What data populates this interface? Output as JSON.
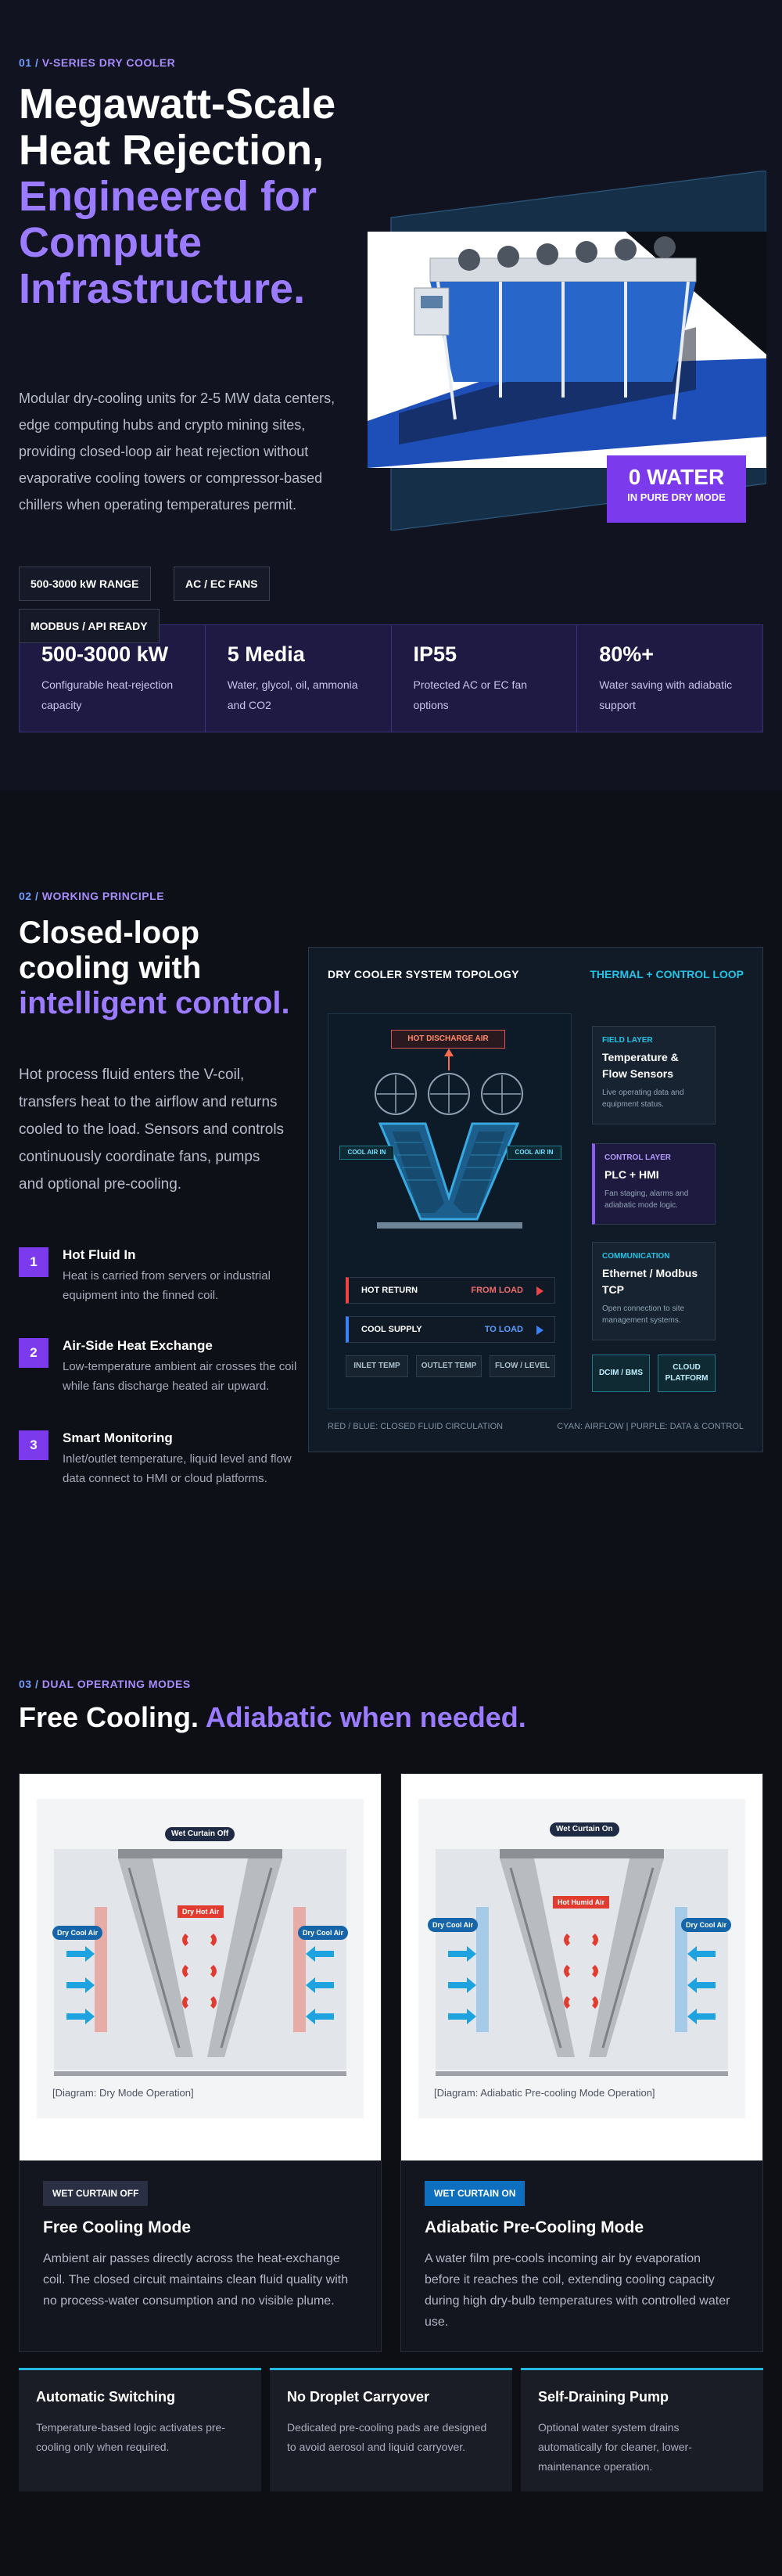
{
  "hero": {
    "eyebrow_num": "01 /",
    "eyebrow_label": "V-SERIES DRY COOLER",
    "title_white": "Megawatt-Scale Heat Rejection,",
    "title_accent": "Engineered for Compute Infrastructure.",
    "description": "Modular dry-cooling units for 2-5 MW data centers, edge computing hubs and crypto mining sites, providing closed-loop air heat rejection without evaporative cooling towers or compressor-based chillers when operating temperatures permit.",
    "tags": [
      "500-3000 kW RANGE",
      "AC / EC FANS",
      "MODBUS / API READY"
    ],
    "badge_big": "0 WATER",
    "badge_small": "IN PURE DRY MODE",
    "stats": [
      {
        "value": "500-3000 kW",
        "label": "Configurable heat-rejection capacity"
      },
      {
        "value": "5 Media",
        "label": "Water, glycol, oil, ammonia and CO2"
      },
      {
        "value": "IP55",
        "label": "Protected AC or EC fan options"
      },
      {
        "value": "80%+",
        "label": "Water saving with adiabatic support"
      }
    ]
  },
  "principle": {
    "eyebrow_num": "02 /",
    "eyebrow_label": "WORKING PRINCIPLE",
    "title_white": "Closed-loop cooling with",
    "title_accent": "intelligent control.",
    "description": "Hot process fluid enters the V-coil, transfers heat to the airflow and returns cooled to the load. Sensors and controls continuously coordinate fans, pumps and optional pre-cooling.",
    "steps": [
      {
        "num": "1",
        "title": "Hot Fluid In",
        "body": "Heat is carried from servers or industrial equipment into the finned coil."
      },
      {
        "num": "2",
        "title": "Air-Side Heat Exchange",
        "body": "Low-temperature ambient air crosses the coil while fans discharge heated air upward."
      },
      {
        "num": "3",
        "title": "Smart Monitoring",
        "body": "Inlet/outlet temperature, liquid level and flow data connect to HMI or cloud platforms."
      }
    ],
    "topology": {
      "title": "DRY COOLER SYSTEM TOPOLOGY",
      "title_right": "THERMAL + CONTROL LOOP",
      "hot_discharge": "HOT DISCHARGE AIR",
      "cool_air_left": "COOL AIR IN",
      "cool_air_right": "COOL AIR IN",
      "hot_return": "HOT RETURN",
      "from_load": "FROM LOAD",
      "cool_supply": "COOL SUPPLY",
      "to_load": "TO LOAD",
      "sensors": [
        "INLET TEMP",
        "OUTLET TEMP",
        "FLOW / LEVEL"
      ],
      "layers": [
        {
          "kicker": "FIELD LAYER",
          "title": "Temperature & Flow Sensors",
          "body": "Live operating data and equipment status."
        },
        {
          "kicker": "CONTROL LAYER",
          "title": "PLC + HMI",
          "body": "Fan staging, alarms and adiabatic mode logic."
        },
        {
          "kicker": "COMMUNICATION",
          "title": "Ethernet / Modbus TCP",
          "body": "Open connection to site management systems."
        }
      ],
      "chip_dcim": "DCIM / BMS",
      "chip_cloud": "CLOUD PLATFORM",
      "foot_left": "RED / BLUE: CLOSED FLUID CIRCULATION",
      "foot_right": "CYAN: AIRFLOW | PURPLE: DATA & CONTROL"
    }
  },
  "modes": {
    "eyebrow_num": "03 /",
    "eyebrow_label": "DUAL OPERATING MODES",
    "title_white": "Free Cooling.",
    "title_accent": "Adiabatic when needed.",
    "cards": [
      {
        "img_top_label": "Wet Curtain Off",
        "left_label": "Dry Cool Air",
        "right_label": "Dry Cool Air",
        "center_label": "Dry Hot Air",
        "caption": "[Diagram: Dry Mode Operation]",
        "badge": "WET CURTAIN OFF",
        "title": "Free Cooling Mode",
        "body": "Ambient air passes directly across the heat-exchange coil. The closed circuit maintains clean fluid quality with no process-water consumption and no visible plume."
      },
      {
        "img_top_label": "Wet Curtain On",
        "left_label": "Dry Cool Air",
        "right_label": "Dry Cool Air",
        "center_label": "Hot Humid Air",
        "caption": "[Diagram: Adiabatic Pre-cooling Mode Operation]",
        "badge": "WET CURTAIN ON",
        "title": "Adiabatic Pre-Cooling Mode",
        "body": "A water film pre-cools incoming air by evaporation before it reaches the coil, extending cooling capacity during high dry-bulb temperatures with controlled water use."
      }
    ],
    "features": [
      {
        "title": "Automatic Switching",
        "body": "Temperature-based logic activates pre-cooling only when required."
      },
      {
        "title": "No Droplet Carryover",
        "body": "Dedicated pre-cooling pads are designed to avoid aerosol and liquid carryover."
      },
      {
        "title": "Self-Draining Pump",
        "body": "Optional water system drains automatically for cleaner, lower-maintenance operation."
      }
    ]
  },
  "colors": {
    "accent_purple": "#9b7bff",
    "badge_purple": "#7c3aed",
    "cyan": "#22c3e6",
    "hot_red": "#ef4444",
    "cool_blue": "#3b82f6",
    "panel_dark": "#111320"
  }
}
